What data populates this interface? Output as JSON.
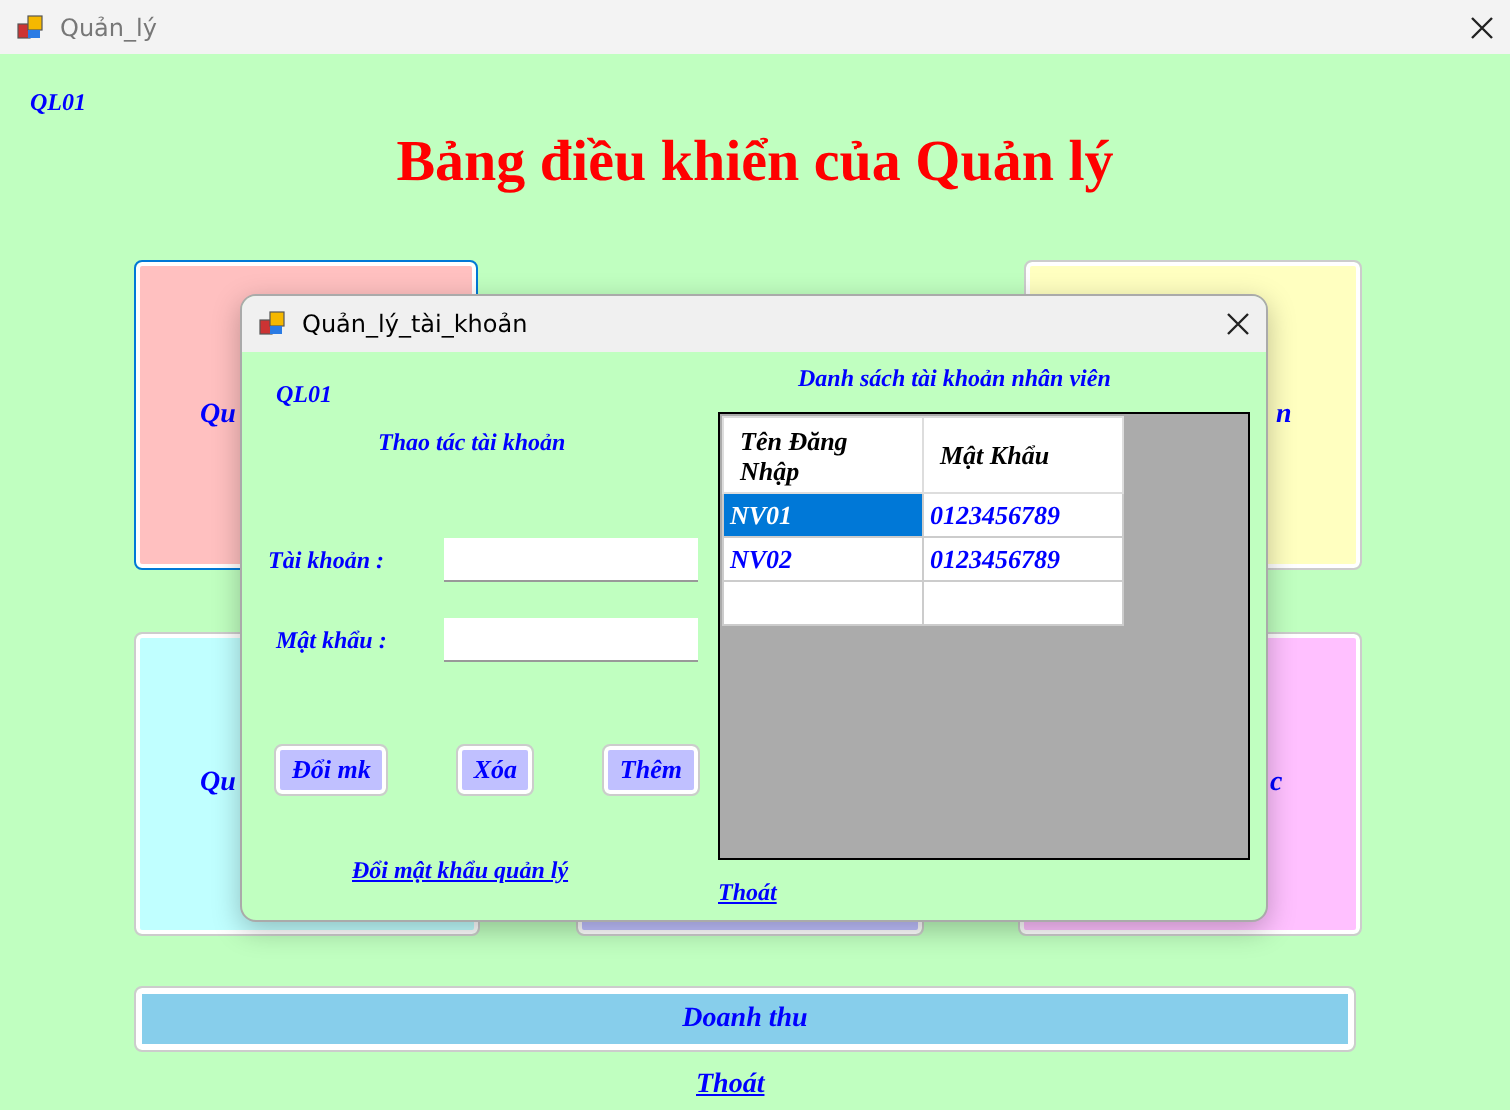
{
  "window": {
    "title": "Quản_lý"
  },
  "user_code": "QL01",
  "heading": "Bảng điều khiển của Quản lý",
  "tile_rows": [
    [
      {
        "label": "Qu",
        "color": "#ffc0c0",
        "focused": true
      },
      {
        "label": "n",
        "color": "#ffffc0",
        "focused": false
      }
    ],
    [
      {
        "label": "Qu",
        "color": "#c0ffff",
        "focused": false
      },
      {
        "color": "#c0c0ff",
        "focused": false
      },
      {
        "label": "c",
        "color": "#ffc0ff",
        "focused": false
      }
    ]
  ],
  "revenue_button": "Doanh thu",
  "exit_link": "Thoát",
  "dialog": {
    "title": "Quản_lý_tài_khoản",
    "user_code": "QL01",
    "section_title": "Thao tác tài khoản",
    "fields": [
      {
        "label": "Tài khoản :"
      },
      {
        "label": "Mật khẩu :"
      }
    ],
    "buttons": [
      "Đổi mk",
      "Xóa",
      "Thêm"
    ],
    "change_password_link": "Đổi mật khẩu quản lý",
    "list_title": "Danh sách tài khoản nhân viên",
    "table": {
      "columns": [
        "Tên Đăng Nhập",
        "Mật Khẩu"
      ],
      "rows": [
        {
          "cells": [
            "NV01",
            "0123456789"
          ],
          "selected": true
        },
        {
          "cells": [
            "NV02",
            "0123456789"
          ],
          "selected": false
        }
      ],
      "new_row": true
    },
    "exit_link": "Thoát"
  }
}
